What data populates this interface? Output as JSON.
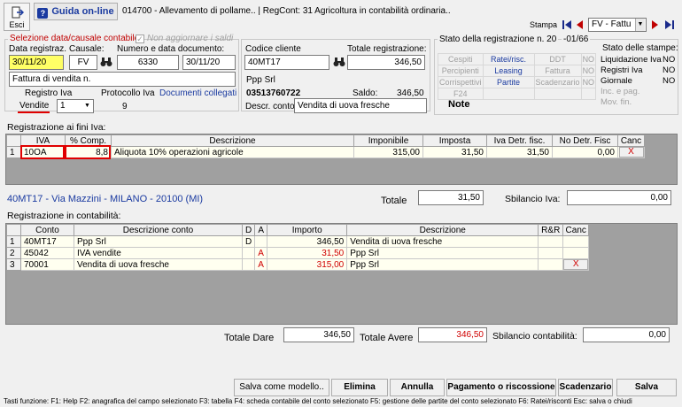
{
  "toolbar": {
    "esci_label": "Esci",
    "guida_label": "Guida on-line",
    "title": "014700 - Allevamento di pollame.. | RegCont: 31 Agricoltura in contabilità ordinaria..",
    "stampa_label": "Stampa",
    "doc_type": "FV - Fattu"
  },
  "selezione": {
    "title": "Selezione data/causale contabile",
    "non_aggiornare": "Non aggiornare i saldi",
    "data_reg_label": "Data registraz.",
    "causale_label": "Causale:",
    "numdata_label": "Numero e data documento:",
    "data_reg": "30/11/20",
    "causale": "FV",
    "numero_doc": "6330",
    "data_doc": "30/11/20",
    "descrizione": "Fattura di vendita n.",
    "registro_label": "Registro Iva",
    "protocollo_label": "Protocollo Iva",
    "doc_collegati": "Documenti collegati",
    "registro_value": "Vendite",
    "registro_num": "1",
    "protocollo": "9"
  },
  "cliente": {
    "codice_label": "Codice cliente",
    "totale_label": "Totale registrazione:",
    "codice": "40MT17",
    "totale": "346,50",
    "nome": "Ppp Srl",
    "telefono": "03513760722",
    "saldo_label": "Saldo:",
    "saldo": "346,50",
    "descr_conto_label": "Descr. conto",
    "descr_conto": "Vendita di uova fresche"
  },
  "stato": {
    "title": "Stato della registrazione n. 20",
    "page": "-01/66",
    "rows": [
      [
        "Cespiti",
        "Ratei/risc.",
        "DDT",
        "NO"
      ],
      [
        "Percipienti",
        "Leasing",
        "Fattura",
        "NO"
      ],
      [
        "Corrispettivi",
        "Partite",
        "Scadenzario",
        "NO"
      ],
      [
        "F24",
        "",
        "",
        ""
      ]
    ],
    "note": "Note",
    "stampe_title": "Stato delle stampe:",
    "stampe": [
      [
        "Liquidazione Iva",
        "NO"
      ],
      [
        "Registri Iva",
        "NO"
      ],
      [
        "Giornale",
        "NO"
      ],
      [
        "Inc. e pag.",
        ""
      ],
      [
        "Mov. fin.",
        ""
      ]
    ]
  },
  "iva": {
    "title": "Registrazione ai fini Iva:",
    "headers": [
      "IVA",
      "% Comp.",
      "Descrizione",
      "Imponibile",
      "Imposta",
      "Iva Detr. fisc.",
      "No Detr. Fisc",
      "Canc"
    ],
    "rows": [
      {
        "n": "1",
        "iva": "10OA",
        "comp": "8,8",
        "descr": "Aliquota 10% operazioni agricole",
        "imponibile": "315,00",
        "imposta": "31,50",
        "detr": "31,50",
        "nodetr": "0,00",
        "canc": "X"
      }
    ],
    "address": "40MT17 - Via Mazzini - MILANO - 20100 (MI)",
    "totale_label": "Totale",
    "totale": "31,50",
    "sbilancio_label": "Sbilancio Iva:",
    "sbilancio": "0,00"
  },
  "contabilita": {
    "title": "Registrazione in contabilità:",
    "headers": [
      "Conto",
      "Descrizione conto",
      "D",
      "A",
      "Importo",
      "Descrizione",
      "R&R",
      "Canc"
    ],
    "rows": [
      {
        "n": "1",
        "conto": "40MT17",
        "descr": "Ppp Srl",
        "d": "D",
        "a": "",
        "importo": "346,50",
        "descr2": "Vendita di uova fresche",
        "rr": "",
        "canc": ""
      },
      {
        "n": "2",
        "conto": "45042",
        "descr": "IVA vendite",
        "d": "",
        "a": "A",
        "importo": "31,50",
        "descr2": "Ppp Srl",
        "rr": "",
        "canc": ""
      },
      {
        "n": "3",
        "conto": "70001",
        "descr": "Vendita di uova fresche",
        "d": "",
        "a": "A",
        "importo": "315,00",
        "descr2": "Ppp Srl",
        "rr": "",
        "canc": "X"
      }
    ],
    "totale_dare_label": "Totale Dare",
    "totale_dare": "346,50",
    "totale_avere_label": "Totale Avere",
    "totale_avere": "346,50",
    "sbilancio_label": "Sbilancio contabilità:",
    "sbilancio": "0,00"
  },
  "buttons": {
    "salva_modello": "Salva come modello..",
    "elimina": "Elimina",
    "annulla": "Annulla",
    "pagamento": "Pagamento o riscossione",
    "scadenzario": "Scadenzario",
    "salva": "Salva"
  },
  "status_bar": "Tasti funzione: F1: Help F2: anagrafica del campo selezionato F3: tabella F4: scheda contabile del conto selezionato F5: gestione delle partite del conto selezionato F6: Ratei/risconti Esc: salva o chiudi"
}
